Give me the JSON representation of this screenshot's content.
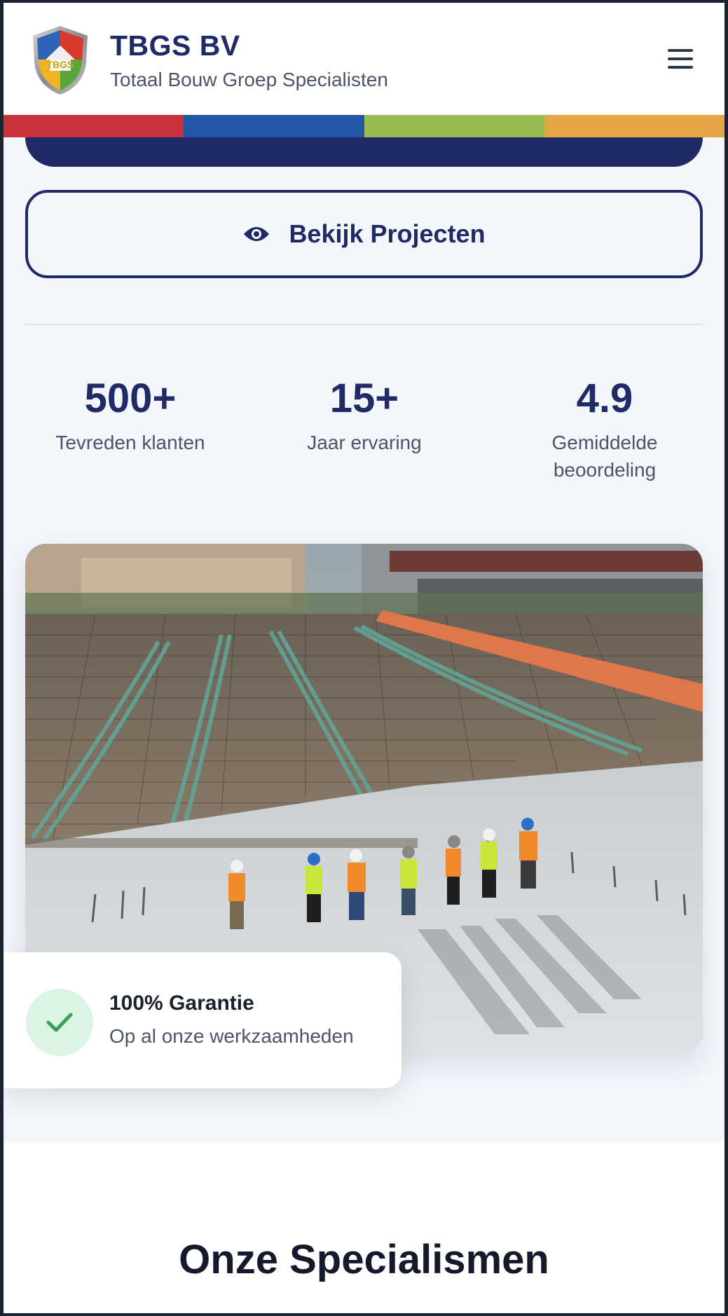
{
  "header": {
    "brand_name": "TBGS BV",
    "tagline": "Totaal Bouw Groep Specialisten",
    "logo_text": "TBGS",
    "menu_icon": "hamburger-menu-icon",
    "stripe_colors": [
      "#c9323a",
      "#2456a6",
      "#97bb52",
      "#e6a643"
    ]
  },
  "hero": {
    "secondary_button_label": "Bekijk Projecten",
    "secondary_button_icon": "eye-icon",
    "primary_color": "#1f2a66"
  },
  "stats": [
    {
      "value": "500+",
      "label": "Tevreden klanten"
    },
    {
      "value": "15+",
      "label": "Jaar ervaring"
    },
    {
      "value": "4.9",
      "label": "Gemiddelde beoordeling"
    }
  ],
  "guarantee": {
    "title": "100% Garantie",
    "subtitle": "Op al onze werkzaamheden",
    "icon": "checkmark-icon"
  },
  "specialisms": {
    "title": "Onze Specialismen"
  }
}
